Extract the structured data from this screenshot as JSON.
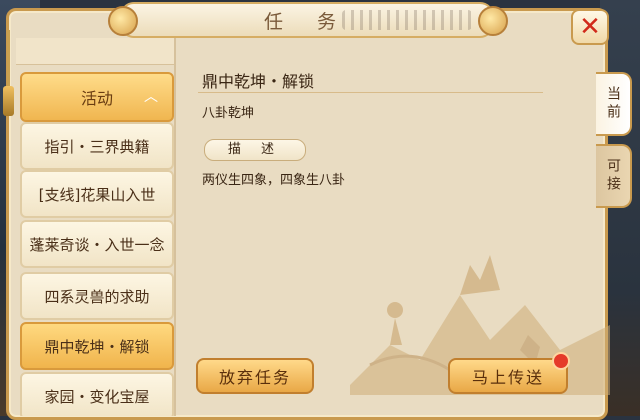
{
  "window": {
    "title": "任 务"
  },
  "sidebar": {
    "header": {
      "label": "活动",
      "icon": "chevron-up-icon"
    },
    "items": [
      {
        "label": "指引・三界典籍"
      },
      {
        "label": "[支线]花果山入世"
      },
      {
        "label": "蓬莱奇谈・入世一念"
      },
      {
        "label": "四系灵兽的求助"
      },
      {
        "label": "鼎中乾坤・解锁",
        "selected": true
      },
      {
        "label": "家园・变化宝屋"
      }
    ]
  },
  "quest": {
    "title": "鼎中乾坤・解锁",
    "subtitle": "八卦乾坤",
    "desc_label": "描 述",
    "description": "两仪生四象，四象生八卦"
  },
  "buttons": {
    "abandon": "放弃任务",
    "teleport": "马上传送"
  },
  "tabs": {
    "current": "当前",
    "available": "可接"
  },
  "colors": {
    "accent": "#f0b650",
    "panel": "#e9dcc2",
    "close": "#d12a1a"
  }
}
